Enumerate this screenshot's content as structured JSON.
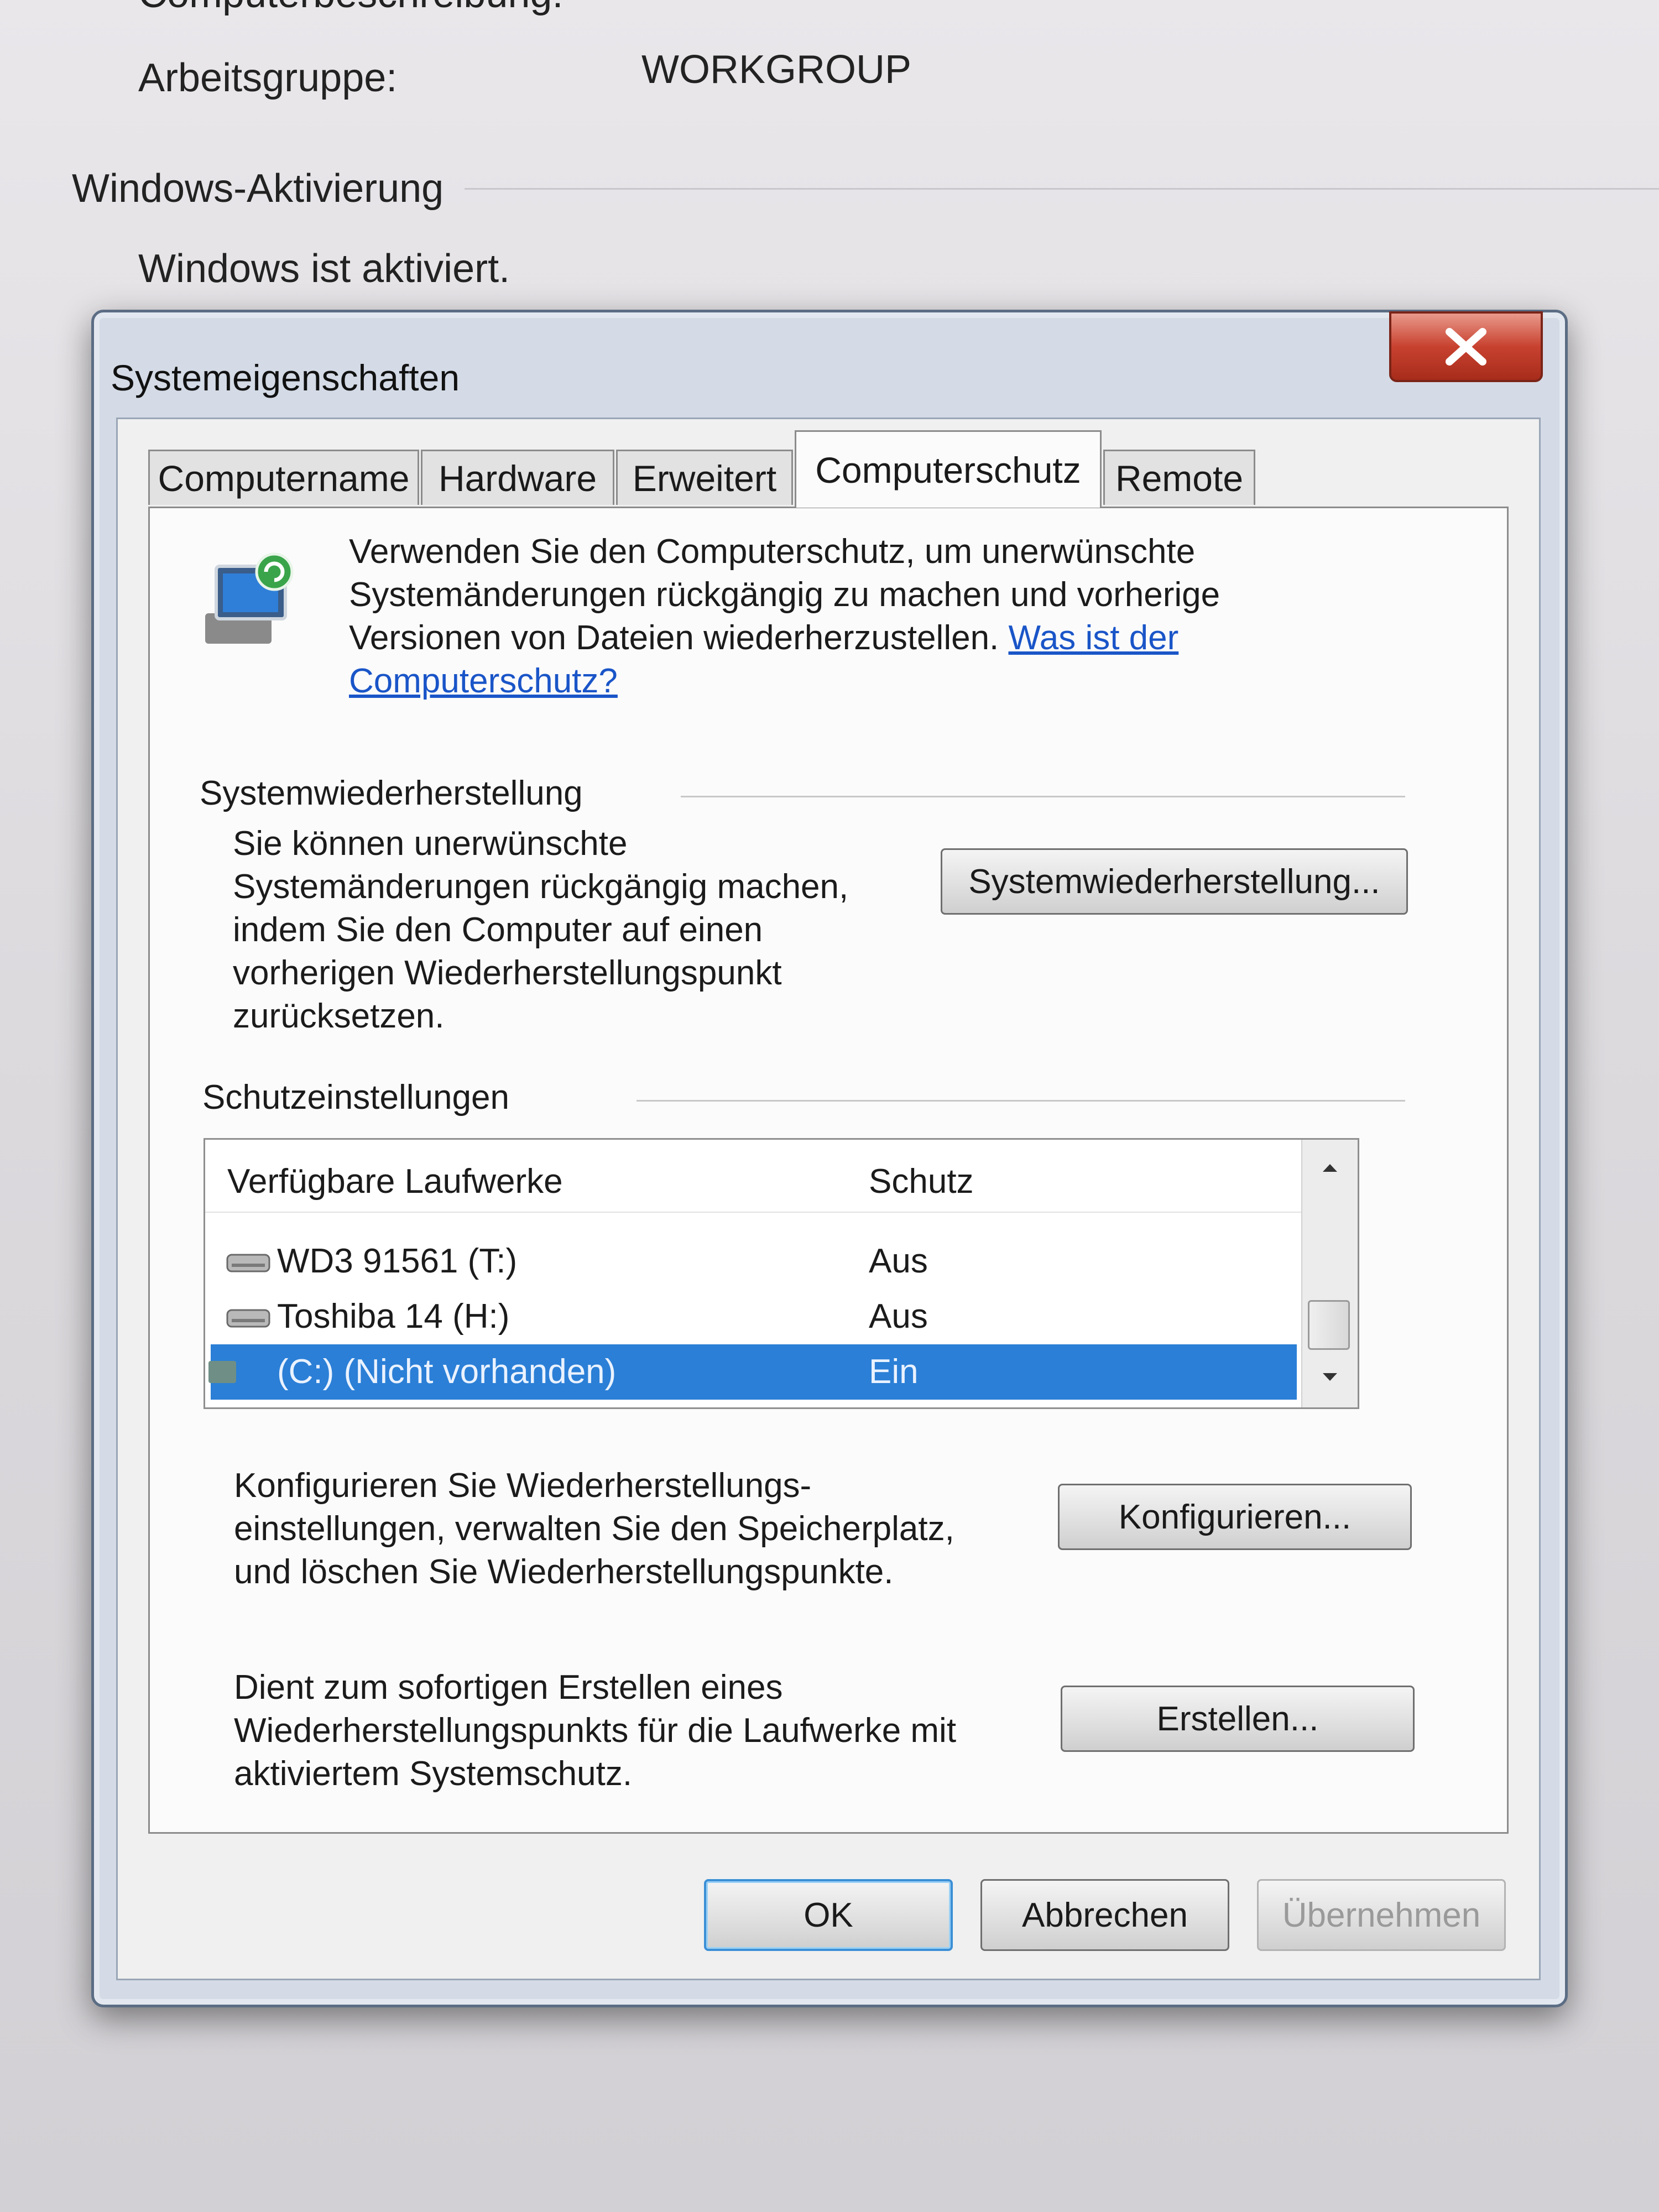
{
  "background": {
    "partial_label": "Computerbeschreibung:",
    "workgroup_label": "Arbeitsgruppe:",
    "workgroup_value": "WORKGROUP",
    "activation_heading": "Windows-Aktivierung",
    "activation_status": "Windows ist aktiviert."
  },
  "dialog": {
    "title": "Systemeigenschaften",
    "close_icon": "close-icon",
    "tabs": [
      {
        "label": "Computername"
      },
      {
        "label": "Hardware"
      },
      {
        "label": "Erweitert"
      },
      {
        "label": "Computerschutz"
      },
      {
        "label": "Remote"
      }
    ],
    "active_tab": "Computerschutz",
    "intro": {
      "line1": "Verwenden Sie den Computerschutz, um unerwünschte",
      "line2": "Systemänderungen rückgängig zu machen und vorherige",
      "line3": "Versionen von Dateien wiederherzustellen.",
      "link_part1": "Was ist der",
      "link_part2": "Computerschutz?"
    },
    "restore": {
      "heading": "Systemwiederherstellung",
      "text": [
        "Sie können unerwünschte",
        "Systemänderungen rückgängig machen,",
        "indem Sie den Computer auf einen",
        "vorherigen Wiederherstellungspunkt",
        "zurücksetzen."
      ],
      "button": "Systemwiederherstellung..."
    },
    "protection": {
      "heading": "Schutzeinstellungen",
      "columns": {
        "drives": "Verfügbare Laufwerke",
        "protection": "Schutz"
      },
      "rows": [
        {
          "drive": "WD3 91561 (T:)",
          "status": "Aus",
          "selected": false
        },
        {
          "drive": "Toshiba 14 (H:)",
          "status": "Aus",
          "selected": false
        },
        {
          "drive": "(C:) (Nicht vorhanden)",
          "status": "Ein",
          "selected": true
        }
      ],
      "configure_text": [
        "Konfigurieren Sie Wiederherstellungs-",
        "einstellungen, verwalten Sie den Speicherplatz,",
        "und löschen Sie Wiederherstellungspunkte."
      ],
      "configure_button": "Konfigurieren...",
      "create_text": [
        "Dient zum sofortigen Erstellen eines",
        "Wiederherstellungspunkts für die Laufwerke mit",
        "aktiviertem Systemschutz."
      ],
      "create_button": "Erstellen..."
    },
    "footer": {
      "ok": "OK",
      "cancel": "Abbrechen",
      "apply": "Übernehmen"
    },
    "colors": {
      "selection": "#2b7fd6",
      "link": "#1a55c8",
      "close": "#c8412f"
    }
  }
}
